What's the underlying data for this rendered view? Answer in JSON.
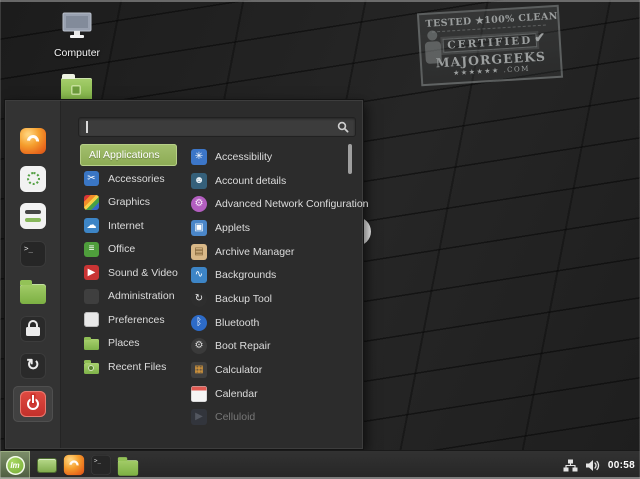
{
  "desktop": {
    "computer_icon_label": "Computer",
    "watermark": {
      "line1": "TESTED ★100% CLEAN",
      "line2": "CERTIFIED",
      "check": "✔",
      "line3": "MAJORGEEKS",
      "line4": "★★★★★★",
      "line4b": ".COM"
    }
  },
  "menu": {
    "search": {
      "value": "",
      "icon": "magnifier-icon"
    },
    "sidebar": [
      {
        "name": "firefox-browser",
        "cls": "si-firefox",
        "glyph": ""
      },
      {
        "name": "software-manager",
        "cls": "si-software",
        "glyph": ""
      },
      {
        "name": "system-settings",
        "cls": "si-settings",
        "glyph": ""
      },
      {
        "name": "terminal",
        "cls": "si-terminal",
        "glyph": ">_"
      },
      {
        "name": "file-manager",
        "cls": "si-files",
        "glyph": ""
      },
      {
        "name": "lock-screen",
        "cls": "si-lock",
        "glyph": ""
      },
      {
        "name": "log-out",
        "cls": "si-logout",
        "glyph": "↻"
      },
      {
        "name": "shut-down",
        "cls": "si-power",
        "glyph": "",
        "highlighted": true
      }
    ],
    "categories": [
      {
        "label": "All Applications",
        "name": "all-applications",
        "selected": true
      },
      {
        "label": "Accessories",
        "name": "accessories",
        "icon": {
          "cls": "ic-sq",
          "glyph": "✂",
          "bg": "#3a76c4",
          "fg": "#ffffff"
        }
      },
      {
        "label": "Graphics",
        "name": "graphics",
        "icon": {
          "cls": "ic-rainbow",
          "glyph": ""
        }
      },
      {
        "label": "Internet",
        "name": "internet",
        "icon": {
          "cls": "ic-sq",
          "glyph": "☁",
          "bg": "#3d85c6",
          "fg": "#ffffff"
        }
      },
      {
        "label": "Office",
        "name": "office",
        "icon": {
          "cls": "ic-sq",
          "glyph": "≡",
          "bg": "#4f9e3c",
          "fg": "#ffffff"
        }
      },
      {
        "label": "Sound & Video",
        "name": "sound-video",
        "icon": {
          "cls": "ic-sq",
          "glyph": "▶",
          "bg": "#c93434",
          "fg": "#ffffff"
        }
      },
      {
        "label": "Administration",
        "name": "administration",
        "icon": {
          "cls": "ic-toggles-dark",
          "glyph": "",
          "bg": "#3f3f3f"
        }
      },
      {
        "label": "Preferences",
        "name": "preferences",
        "icon": {
          "cls": "ic-toggles-light",
          "glyph": "",
          "bg": "#e8e8e8"
        }
      },
      {
        "label": "Places",
        "name": "places",
        "icon": {
          "cls": "ic-folder",
          "glyph": ""
        }
      },
      {
        "label": "Recent Files",
        "name": "recent-files",
        "icon": {
          "cls": "ic-folder ic-recent",
          "glyph": ""
        }
      }
    ],
    "apps": [
      {
        "label": "Accessibility",
        "name": "accessibility",
        "icon": {
          "cls": "ic-sq",
          "glyph": "✳",
          "bg": "#3c76c8",
          "fg": "#ffffff"
        }
      },
      {
        "label": "Account details",
        "name": "account-details",
        "icon": {
          "cls": "ic-sq",
          "glyph": "☻",
          "bg": "#35607a",
          "fg": "#e8f0f5"
        }
      },
      {
        "label": "Advanced Network Configuration",
        "name": "advanced-network-configuration",
        "icon": {
          "cls": "ic-round",
          "glyph": "⚙",
          "bg": "#b35ec0",
          "fg": "#f5e8f7"
        }
      },
      {
        "label": "Applets",
        "name": "applets",
        "icon": {
          "cls": "ic-sq",
          "glyph": "▣",
          "bg": "#4a86c8",
          "fg": "#ffffff"
        }
      },
      {
        "label": "Archive Manager",
        "name": "archive-manager",
        "icon": {
          "cls": "ic-sq",
          "glyph": "▤",
          "bg": "#d9b887",
          "fg": "#7a5c30"
        }
      },
      {
        "label": "Backgrounds",
        "name": "backgrounds",
        "icon": {
          "cls": "ic-sq",
          "glyph": "∿",
          "bg": "#3d85c6",
          "fg": "#ffffff"
        }
      },
      {
        "label": "Backup Tool",
        "name": "backup-tool",
        "icon": {
          "cls": "ic-round",
          "glyph": "↻",
          "bg": "#2e2e2e",
          "fg": "#e8e8e8"
        }
      },
      {
        "label": "Bluetooth",
        "name": "bluetooth",
        "icon": {
          "cls": "ic-round",
          "glyph": "ᛒ",
          "bg": "#2d6bc8",
          "fg": "#ffffff"
        }
      },
      {
        "label": "Boot Repair",
        "name": "boot-repair",
        "icon": {
          "cls": "ic-round",
          "glyph": "⚙",
          "bg": "#3a3a3a",
          "fg": "#d8d8d8"
        }
      },
      {
        "label": "Calculator",
        "name": "calculator",
        "icon": {
          "cls": "ic-sq",
          "glyph": "▦",
          "bg": "#3f3f3f",
          "fg": "#e8a23c"
        }
      },
      {
        "label": "Calendar",
        "name": "calendar",
        "icon": {
          "cls": "ic-cal",
          "glyph": ""
        }
      },
      {
        "label": "Celluloid",
        "name": "celluloid",
        "disabled": true,
        "icon": {
          "cls": "ic-sq",
          "glyph": "▶",
          "bg": "#3b4252",
          "fg": "#8a92a8"
        }
      }
    ]
  },
  "taskbar": {
    "menu_logo_text": "lm",
    "launchers": [
      {
        "name": "show-desktop",
        "cls": "tb-desk",
        "glyph": ""
      },
      {
        "name": "firefox-browser",
        "cls": "si-firefox",
        "glyph": ""
      },
      {
        "name": "terminal",
        "cls": "si-terminal",
        "glyph": ">_"
      },
      {
        "name": "file-manager",
        "cls": "si-files",
        "glyph": ""
      }
    ],
    "tray": {
      "clock": "00:58",
      "icons": [
        "network-icon",
        "volume-icon"
      ]
    }
  },
  "colors": {
    "accent_green": "#8fb562",
    "selected_category_bg": "#94b565",
    "panel_bg": "#2c2c2c",
    "taskbar_bg": "#2b2b2b",
    "shutdown_red": "#cc342c"
  }
}
